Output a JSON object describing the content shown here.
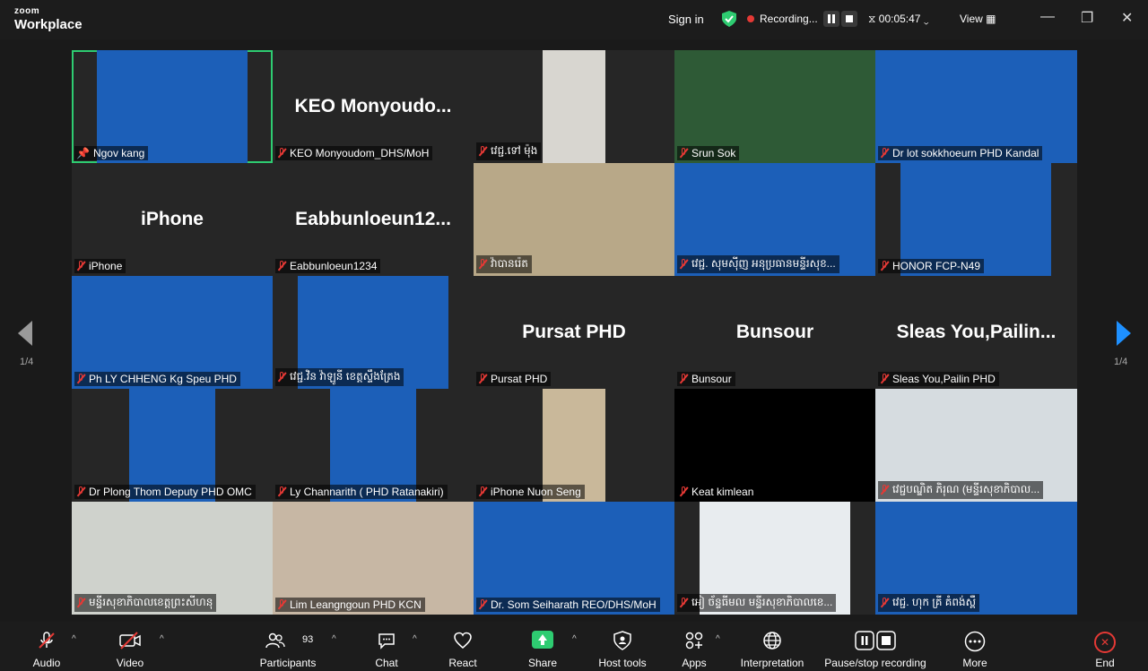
{
  "app": {
    "logo_line1": "zoom",
    "logo_line2": "Workplace"
  },
  "header": {
    "sign_in": "Sign in",
    "recording_label": "Recording...",
    "timer": "00:05:47",
    "view_label": "View"
  },
  "pagination": {
    "left": "1/4",
    "right": "1/4"
  },
  "participants": [
    {
      "name": "Ngov kang",
      "type": "video",
      "active": true
    },
    {
      "name": "KEO Monyoudom_DHS/MoH",
      "type": "name",
      "display": "KEO  Monyoudo..."
    },
    {
      "name": "វេជ្ជ.ទៅ ម៉ុង",
      "type": "video"
    },
    {
      "name": "Srun Sok",
      "type": "video"
    },
    {
      "name": "Dr lot sokkhoeurn PHD Kandal",
      "type": "video"
    },
    {
      "name": "iPhone",
      "type": "name",
      "display": "iPhone"
    },
    {
      "name": "Eabbunloeun1234",
      "type": "name",
      "display": "Eabbunloeun12..."
    },
    {
      "name": "វ៉ាបានរ៉េត",
      "type": "video"
    },
    {
      "name": "វេជ្ជ. សុមសុីញ  អនុប្រធានមន្ទីរសុខ...",
      "type": "video"
    },
    {
      "name": "HONOR FCP-N49",
      "type": "video"
    },
    {
      "name": "Ph LY CHHENG Kg Speu PHD",
      "type": "video"
    },
    {
      "name": "វេជ្ជ.វិន វ៉ាឡូនី ខេត្តស្ទឹងត្រែង",
      "type": "video"
    },
    {
      "name": "Pursat PHD",
      "type": "name",
      "display": "Pursat PHD"
    },
    {
      "name": "Bunsour",
      "type": "name",
      "display": "Bunsour"
    },
    {
      "name": "Sleas You,Pailin PHD",
      "type": "name",
      "display": "Sleas  You,Pailin..."
    },
    {
      "name": "Dr Plong Thom Deputy PHD OMC",
      "type": "video"
    },
    {
      "name": "Ly Channarith ( PHD Ratanakiri)",
      "type": "video"
    },
    {
      "name": "iPhone Nuon Seng",
      "type": "video"
    },
    {
      "name": "Keat kimlean",
      "type": "black"
    },
    {
      "name": "វេជ្ជបណ្ឌិត ភិរុណ (មន្ទីរសុខាភិបាល...",
      "type": "video"
    },
    {
      "name": "មន្ទីរសុខាភិបាលខេត្តព្រះសីហនុ",
      "type": "video"
    },
    {
      "name": "Lim Leangngoun PHD KCN",
      "type": "video"
    },
    {
      "name": "Dr. Som Seiharath REO/DHS/MoH",
      "type": "video"
    },
    {
      "name": "អៀ ច័ន្ទធីមល មន្ទីរសុខាភិបាលខេ...",
      "type": "video"
    },
    {
      "name": "វេជ្ជ. ហុក គ្រី  គំពង់ស្ពឺ",
      "type": "video"
    }
  ],
  "toolbar": {
    "audio": "Audio",
    "video": "Video",
    "participants": "Participants",
    "participant_count": "93",
    "chat": "Chat",
    "react": "React",
    "share": "Share",
    "host_tools": "Host tools",
    "apps": "Apps",
    "interpretation": "Interpretation",
    "pause_stop_recording": "Pause/stop recording",
    "more": "More",
    "end": "End"
  },
  "colors": {
    "active_border": "#2ecc71",
    "recording": "#e53935",
    "share": "#2ecc71",
    "nav_arrow": "#1e90ff"
  }
}
